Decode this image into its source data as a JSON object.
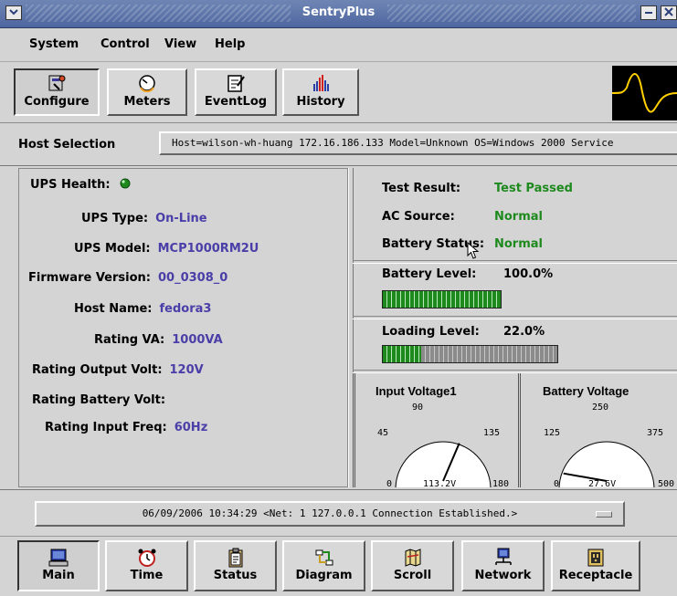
{
  "window": {
    "title": "SentryPlus"
  },
  "menu": {
    "items": [
      {
        "label": "System",
        "key": "S"
      },
      {
        "label": "Control",
        "key": "C"
      },
      {
        "label": "View",
        "key": "V"
      },
      {
        "label": "Help",
        "key": "H"
      }
    ]
  },
  "toolbar": {
    "configure": "Configure",
    "meters": "Meters",
    "eventlog": "EventLog",
    "history": "History"
  },
  "host": {
    "label": "Host Selection",
    "value": "Host=wilson-wh-huang 172.16.186.133 Model=Unknown OS=Windows 2000 Service"
  },
  "info": {
    "ups_health_label": "UPS Health:",
    "ups_health_status": "green",
    "ups_type_label": "UPS Type:",
    "ups_type": "On-Line",
    "ups_model_label": "UPS Model:",
    "ups_model": "MCP1000RM2U",
    "firmware_label": "Firmware Version:",
    "firmware": "00_0308_0",
    "host_name_label": "Host Name:",
    "host_name": "fedora3",
    "rating_va_label": "Rating VA:",
    "rating_va": "1000VA",
    "rating_output_volt_label": "Rating Output Volt:",
    "rating_output_volt": "120V",
    "rating_battery_volt_label": "Rating Battery Volt:",
    "rating_battery_volt": "",
    "rating_input_freq_label": "Rating Input Freq:",
    "rating_input_freq": "60Hz"
  },
  "status": {
    "test_result_label": "Test Result:",
    "test_result": "Test Passed",
    "ac_source_label": "AC Source:",
    "ac_source": "Normal",
    "battery_status_label": "Battery Status:",
    "battery_status": "Normal"
  },
  "levels": {
    "battery_label": "Battery Level:",
    "battery_value": "100.0%",
    "battery_fraction": 1.0,
    "loading_label": "Loading Level:",
    "loading_value": "22.0%",
    "loading_fraction": 0.22
  },
  "gauges": {
    "input": {
      "title": "Input Voltage1",
      "min": "0",
      "low": "45",
      "mid": "90",
      "high": "135",
      "max": "180",
      "reading": "113.2V",
      "value": 113.2,
      "range": [
        0,
        180
      ]
    },
    "battery": {
      "title": "Battery Voltage",
      "min": "0",
      "low": "125",
      "mid": "250",
      "high": "375",
      "max": "500",
      "reading": "27.6V",
      "value": 27.6,
      "range": [
        0,
        500
      ]
    }
  },
  "statusbar": {
    "message": "06/09/2006 10:34:29  <Net: 1 127.0.0.1 Connection Established.>"
  },
  "nav": {
    "main": "Main",
    "time": "Time",
    "status": "Status",
    "diagram": "Diagram",
    "scroll": "Scroll",
    "network": "Network",
    "receptacle": "Receptacle"
  },
  "colors": {
    "title_bar": "#5b73a8",
    "accent_green": "#1e8a1e",
    "value_blue": "#4a3ea8"
  }
}
